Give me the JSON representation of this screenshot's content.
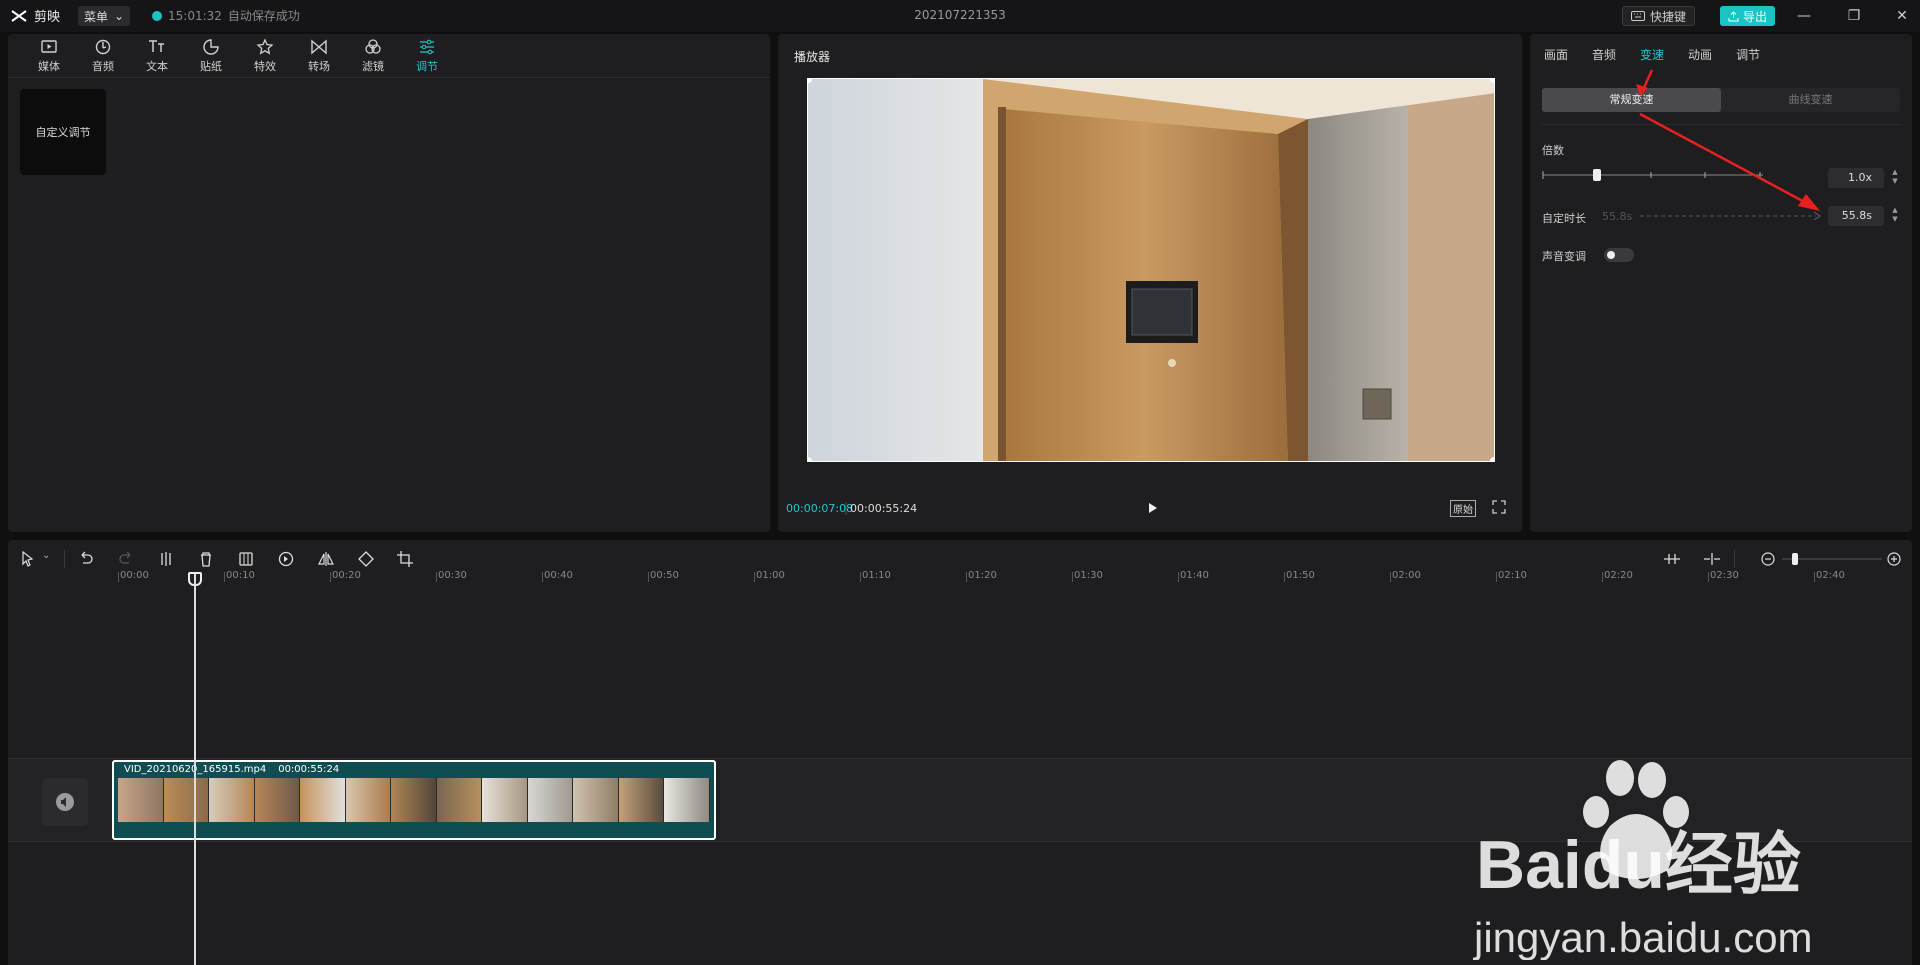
{
  "titlebar": {
    "app_name": "剪映",
    "menu_label": "菜单",
    "autosave_time": "15:01:32",
    "autosave_text": "自动保存成功",
    "project_name": "202107221353",
    "shortcut_label": "快捷键",
    "export_label": "导出"
  },
  "left_panel": {
    "tools": [
      {
        "label": "媒体",
        "icon": "media-icon"
      },
      {
        "label": "音频",
        "icon": "audio-icon"
      },
      {
        "label": "文本",
        "icon": "text-icon"
      },
      {
        "label": "贴纸",
        "icon": "sticker-icon"
      },
      {
        "label": "特效",
        "icon": "effects-icon"
      },
      {
        "label": "转场",
        "icon": "transition-icon"
      },
      {
        "label": "滤镜",
        "icon": "filter-icon"
      },
      {
        "label": "调节",
        "icon": "adjust-icon"
      }
    ],
    "active_tool": "调节",
    "preset_label": "自定义调节"
  },
  "player": {
    "title": "播放器",
    "current_time": "00:00:07:08",
    "total_time": "00:00:55:24",
    "original_label": "原始"
  },
  "right_panel": {
    "tabs": [
      "画面",
      "音频",
      "变速",
      "动画",
      "调节"
    ],
    "active_tab": "变速",
    "segments": [
      "常规变速",
      "曲线变速"
    ],
    "active_segment": "常规变速",
    "multiplier_label": "倍数",
    "multiplier_value": "1.0x",
    "duration_label": "自定时长",
    "duration_from": "55.8s",
    "duration_value": "55.8s",
    "pitch_label": "声音变调",
    "pitch_on": false
  },
  "timeline": {
    "ruler_labels": [
      "00:00",
      "00:10",
      "00:20",
      "00:30",
      "00:40",
      "00:50",
      "01:00",
      "01:10",
      "01:20",
      "01:30",
      "01:40",
      "01:50",
      "02:00",
      "02:10",
      "02:20",
      "02:30",
      "02:40"
    ],
    "clip_name": "VID_20210620_165915.mp4",
    "clip_duration": "00:00:55:24"
  },
  "watermark": {
    "brand": "Baidu经验",
    "url": "jingyan.baidu.com"
  },
  "colors": {
    "accent": "#1ec8d0",
    "annotation_arrow": "#e82020"
  }
}
